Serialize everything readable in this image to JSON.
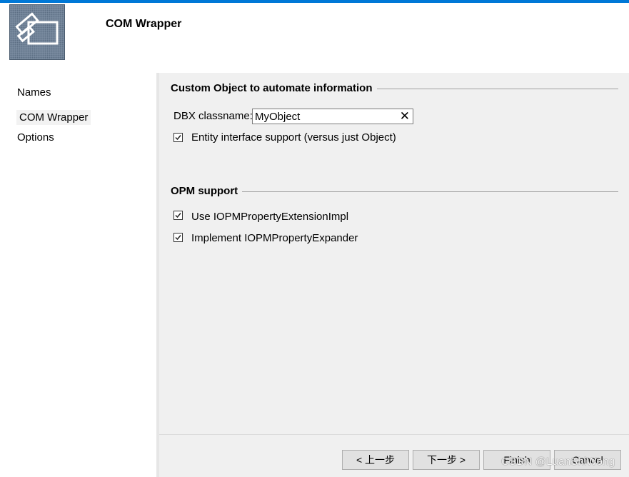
{
  "header": {
    "title": "COM Wrapper",
    "logo_icon": "com-wrapper-wizard-logo"
  },
  "sidebar": {
    "items": [
      {
        "label": "Names",
        "selected": false
      },
      {
        "label": "COM Wrapper",
        "selected": true
      },
      {
        "label": "Options",
        "selected": false
      }
    ]
  },
  "groups": {
    "custom_object": {
      "title": "Custom Object to automate information",
      "classname_label": "DBX classname:",
      "classname_value": "MyObject",
      "entity_support": {
        "label": "Entity interface support (versus just Object)",
        "checked": true
      }
    },
    "opm": {
      "title": "OPM support",
      "options": [
        {
          "label": "Use IOPMPropertyExtensionImpl",
          "checked": true
        },
        {
          "label": "Implement IOPMPropertyExpander",
          "checked": true
        }
      ]
    }
  },
  "footer": {
    "back_label": "< 上一步",
    "next_label": "下一步 >",
    "finish_label": "Finish",
    "cancel_label": "Cancel"
  },
  "watermark": "CSDN @LuanShiWong",
  "colors": {
    "accent": "#0078d7",
    "window_bg": "#f0f0f0"
  }
}
